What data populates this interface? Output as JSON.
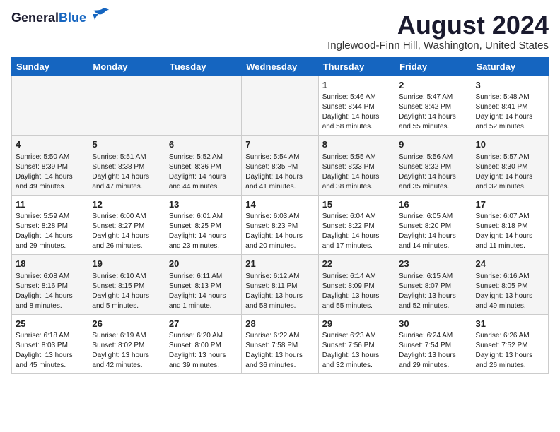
{
  "logo": {
    "line1": "General",
    "line2": "Blue"
  },
  "title": "August 2024",
  "location": "Inglewood-Finn Hill, Washington, United States",
  "weekdays": [
    "Sunday",
    "Monday",
    "Tuesday",
    "Wednesday",
    "Thursday",
    "Friday",
    "Saturday"
  ],
  "weeks": [
    [
      {
        "day": "",
        "info": ""
      },
      {
        "day": "",
        "info": ""
      },
      {
        "day": "",
        "info": ""
      },
      {
        "day": "",
        "info": ""
      },
      {
        "day": "1",
        "info": "Sunrise: 5:46 AM\nSunset: 8:44 PM\nDaylight: 14 hours\nand 58 minutes."
      },
      {
        "day": "2",
        "info": "Sunrise: 5:47 AM\nSunset: 8:42 PM\nDaylight: 14 hours\nand 55 minutes."
      },
      {
        "day": "3",
        "info": "Sunrise: 5:48 AM\nSunset: 8:41 PM\nDaylight: 14 hours\nand 52 minutes."
      }
    ],
    [
      {
        "day": "4",
        "info": "Sunrise: 5:50 AM\nSunset: 8:39 PM\nDaylight: 14 hours\nand 49 minutes."
      },
      {
        "day": "5",
        "info": "Sunrise: 5:51 AM\nSunset: 8:38 PM\nDaylight: 14 hours\nand 47 minutes."
      },
      {
        "day": "6",
        "info": "Sunrise: 5:52 AM\nSunset: 8:36 PM\nDaylight: 14 hours\nand 44 minutes."
      },
      {
        "day": "7",
        "info": "Sunrise: 5:54 AM\nSunset: 8:35 PM\nDaylight: 14 hours\nand 41 minutes."
      },
      {
        "day": "8",
        "info": "Sunrise: 5:55 AM\nSunset: 8:33 PM\nDaylight: 14 hours\nand 38 minutes."
      },
      {
        "day": "9",
        "info": "Sunrise: 5:56 AM\nSunset: 8:32 PM\nDaylight: 14 hours\nand 35 minutes."
      },
      {
        "day": "10",
        "info": "Sunrise: 5:57 AM\nSunset: 8:30 PM\nDaylight: 14 hours\nand 32 minutes."
      }
    ],
    [
      {
        "day": "11",
        "info": "Sunrise: 5:59 AM\nSunset: 8:28 PM\nDaylight: 14 hours\nand 29 minutes."
      },
      {
        "day": "12",
        "info": "Sunrise: 6:00 AM\nSunset: 8:27 PM\nDaylight: 14 hours\nand 26 minutes."
      },
      {
        "day": "13",
        "info": "Sunrise: 6:01 AM\nSunset: 8:25 PM\nDaylight: 14 hours\nand 23 minutes."
      },
      {
        "day": "14",
        "info": "Sunrise: 6:03 AM\nSunset: 8:23 PM\nDaylight: 14 hours\nand 20 minutes."
      },
      {
        "day": "15",
        "info": "Sunrise: 6:04 AM\nSunset: 8:22 PM\nDaylight: 14 hours\nand 17 minutes."
      },
      {
        "day": "16",
        "info": "Sunrise: 6:05 AM\nSunset: 8:20 PM\nDaylight: 14 hours\nand 14 minutes."
      },
      {
        "day": "17",
        "info": "Sunrise: 6:07 AM\nSunset: 8:18 PM\nDaylight: 14 hours\nand 11 minutes."
      }
    ],
    [
      {
        "day": "18",
        "info": "Sunrise: 6:08 AM\nSunset: 8:16 PM\nDaylight: 14 hours\nand 8 minutes."
      },
      {
        "day": "19",
        "info": "Sunrise: 6:10 AM\nSunset: 8:15 PM\nDaylight: 14 hours\nand 5 minutes."
      },
      {
        "day": "20",
        "info": "Sunrise: 6:11 AM\nSunset: 8:13 PM\nDaylight: 14 hours\nand 1 minute."
      },
      {
        "day": "21",
        "info": "Sunrise: 6:12 AM\nSunset: 8:11 PM\nDaylight: 13 hours\nand 58 minutes."
      },
      {
        "day": "22",
        "info": "Sunrise: 6:14 AM\nSunset: 8:09 PM\nDaylight: 13 hours\nand 55 minutes."
      },
      {
        "day": "23",
        "info": "Sunrise: 6:15 AM\nSunset: 8:07 PM\nDaylight: 13 hours\nand 52 minutes."
      },
      {
        "day": "24",
        "info": "Sunrise: 6:16 AM\nSunset: 8:05 PM\nDaylight: 13 hours\nand 49 minutes."
      }
    ],
    [
      {
        "day": "25",
        "info": "Sunrise: 6:18 AM\nSunset: 8:03 PM\nDaylight: 13 hours\nand 45 minutes."
      },
      {
        "day": "26",
        "info": "Sunrise: 6:19 AM\nSunset: 8:02 PM\nDaylight: 13 hours\nand 42 minutes."
      },
      {
        "day": "27",
        "info": "Sunrise: 6:20 AM\nSunset: 8:00 PM\nDaylight: 13 hours\nand 39 minutes."
      },
      {
        "day": "28",
        "info": "Sunrise: 6:22 AM\nSunset: 7:58 PM\nDaylight: 13 hours\nand 36 minutes."
      },
      {
        "day": "29",
        "info": "Sunrise: 6:23 AM\nSunset: 7:56 PM\nDaylight: 13 hours\nand 32 minutes."
      },
      {
        "day": "30",
        "info": "Sunrise: 6:24 AM\nSunset: 7:54 PM\nDaylight: 13 hours\nand 29 minutes."
      },
      {
        "day": "31",
        "info": "Sunrise: 6:26 AM\nSunset: 7:52 PM\nDaylight: 13 hours\nand 26 minutes."
      }
    ]
  ]
}
